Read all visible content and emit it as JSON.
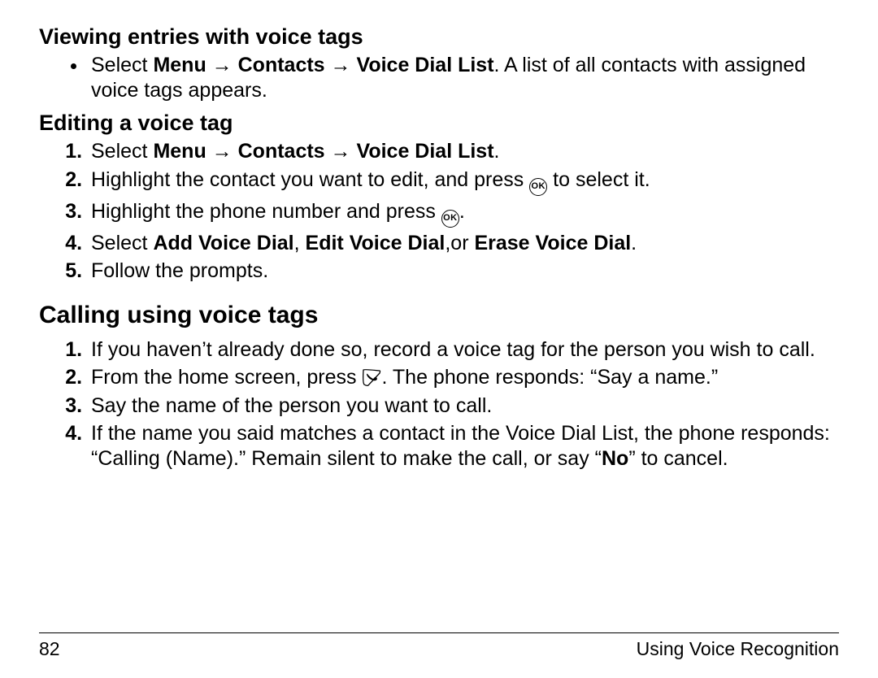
{
  "section1": {
    "heading": "Viewing entries with voice tags",
    "bullet1_pre": "Select ",
    "bullet1_menu": "Menu",
    "bullet1_arrow1": " → ",
    "bullet1_contacts": "Contacts",
    "bullet1_arrow2": " → ",
    "bullet1_vdl": "Voice Dial List",
    "bullet1_post": ". A list of all contacts with assigned voice tags appears."
  },
  "section2": {
    "heading": "Editing a voice tag",
    "s1_pre": "Select ",
    "s1_menu": "Menu",
    "s1_arrow1": " → ",
    "s1_contacts": "Contacts",
    "s1_arrow2": " → ",
    "s1_vdl": "Voice Dial List",
    "s1_post": ".",
    "s2_pre": "Highlight the contact you want to edit, and press ",
    "s2_post": " to select it.",
    "s3_pre": "Highlight the phone number and press ",
    "s3_post": ".",
    "s4_pre": "Select ",
    "s4_add": "Add Voice Dial",
    "s4_comma1": ", ",
    "s4_edit": "Edit Voice Dial",
    "s4_comma2": ",or ",
    "s4_erase": "Erase Voice Dial",
    "s4_post": ".",
    "s5": "Follow the prompts."
  },
  "section3": {
    "heading": "Calling using voice tags",
    "s1": "If you haven’t already done so, record a voice tag for the person you wish to call.",
    "s2_pre": "From the home screen, press ",
    "s2_post": ". The phone responds: “Say a name.”",
    "s3": "Say the name of the person you want to call.",
    "s4_pre": "If the name you said matches a contact in the Voice Dial List, the phone responds: “Calling (Name).” Remain silent to make the call, or say “",
    "s4_no": "No",
    "s4_post": "” to cancel."
  },
  "icons": {
    "ok": "OK"
  },
  "footer": {
    "page": "82",
    "title": "Using Voice Recognition"
  }
}
